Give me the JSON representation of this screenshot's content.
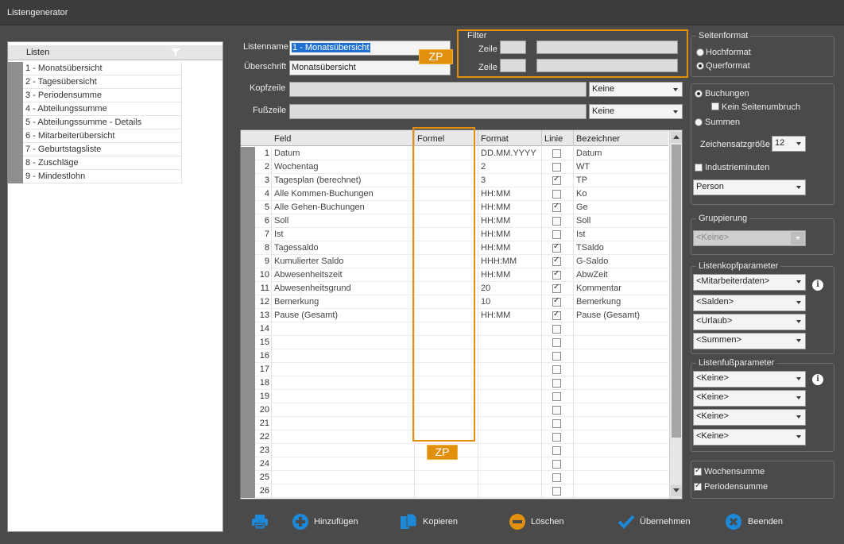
{
  "window": {
    "title": "Listengenerator"
  },
  "lists": {
    "header": "Listen",
    "items": [
      "1 - Monatsübersicht",
      "2 - Tagesübersicht",
      "3 - Periodensumme",
      "4 - Abteilungssumme",
      "5 - Abteilungssumme  - Details",
      "6 - Mitarbeiterübersicht",
      "7 - Geburtstagsliste",
      "8 - Zuschläge",
      "9 - Mindestlohn"
    ]
  },
  "form": {
    "listenname_label": "Listenname",
    "listenname_value": "1 - Monatsübersicht",
    "ueberschrift_label": "Überschrift",
    "ueberschrift_value": "Monatsübersicht",
    "kopfzeile_label": "Kopfzeile",
    "kopfzeile_value": "Keine",
    "fusszeile_label": "Fußzeile",
    "fusszeile_value": "Keine",
    "zp_label": "ZP"
  },
  "filter": {
    "title": "Filter",
    "zeile1_label": "Zeile",
    "zeile2_label": "Zeile"
  },
  "grid": {
    "columns": [
      "Feld",
      "Formel",
      "Format",
      "Linie",
      "Bezeichner"
    ],
    "rows": [
      {
        "nr": "1",
        "feld": "Datum",
        "format": "DD.MM.YYYY",
        "linie": false,
        "bez": "Datum"
      },
      {
        "nr": "2",
        "feld": "Wochentag",
        "format": "2",
        "linie": false,
        "bez": "WT"
      },
      {
        "nr": "3",
        "feld": "Tagesplan (berechnet)",
        "format": "3",
        "linie": true,
        "bez": "TP"
      },
      {
        "nr": "4",
        "feld": "Alle Kommen-Buchungen",
        "format": "HH:MM",
        "linie": false,
        "bez": "Ko"
      },
      {
        "nr": "5",
        "feld": "Alle Gehen-Buchungen",
        "format": "HH:MM",
        "linie": true,
        "bez": "Ge"
      },
      {
        "nr": "6",
        "feld": "Soll",
        "format": "HH:MM",
        "linie": false,
        "bez": "Soll"
      },
      {
        "nr": "7",
        "feld": "Ist",
        "format": "HH:MM",
        "linie": false,
        "bez": "Ist"
      },
      {
        "nr": "8",
        "feld": "Tagessaldo",
        "format": "HH:MM",
        "linie": true,
        "bez": "TSaldo"
      },
      {
        "nr": "9",
        "feld": "Kumulierter Saldo",
        "format": "HHH:MM",
        "linie": true,
        "bez": "G-Saldo"
      },
      {
        "nr": "10",
        "feld": "Abwesenheitszeit",
        "format": "HH:MM",
        "linie": true,
        "bez": "AbwZeit"
      },
      {
        "nr": "11",
        "feld": "Abwesenheitsgrund",
        "format": "20",
        "linie": true,
        "bez": "Kommentar"
      },
      {
        "nr": "12",
        "feld": "Bemerkung",
        "format": "10",
        "linie": true,
        "bez": "Bemerkung"
      },
      {
        "nr": "13",
        "feld": "Pause (Gesamt)",
        "format": "HH:MM",
        "linie": true,
        "bez": "Pause (Gesamt)"
      },
      {
        "nr": "14",
        "feld": "",
        "format": "",
        "linie": false,
        "bez": ""
      },
      {
        "nr": "15",
        "feld": "",
        "format": "",
        "linie": false,
        "bez": ""
      },
      {
        "nr": "16",
        "feld": "",
        "format": "",
        "linie": false,
        "bez": ""
      },
      {
        "nr": "17",
        "feld": "",
        "format": "",
        "linie": false,
        "bez": ""
      },
      {
        "nr": "18",
        "feld": "",
        "format": "",
        "linie": false,
        "bez": ""
      },
      {
        "nr": "19",
        "feld": "",
        "format": "",
        "linie": false,
        "bez": ""
      },
      {
        "nr": "20",
        "feld": "",
        "format": "",
        "linie": false,
        "bez": ""
      },
      {
        "nr": "21",
        "feld": "",
        "format": "",
        "linie": false,
        "bez": ""
      },
      {
        "nr": "22",
        "feld": "",
        "format": "",
        "linie": false,
        "bez": ""
      },
      {
        "nr": "23",
        "feld": "",
        "format": "",
        "linie": false,
        "bez": ""
      },
      {
        "nr": "24",
        "feld": "",
        "format": "",
        "linie": false,
        "bez": ""
      },
      {
        "nr": "25",
        "feld": "",
        "format": "",
        "linie": false,
        "bez": ""
      },
      {
        "nr": "26",
        "feld": "",
        "format": "",
        "linie": false,
        "bez": ""
      }
    ]
  },
  "seitenformat": {
    "title": "Seitenformat",
    "hochformat": "Hochformat",
    "querformat": "Querformat",
    "selected": "querformat"
  },
  "options": {
    "buchungen": "Buchungen",
    "kein_seitenumbruch": "Kein Seitenumbruch",
    "summen": "Summen",
    "zeichensatz_label": "Zeichensatzgröße",
    "zeichensatz_value": "12",
    "industrieminuten": "Industrieminuten",
    "person_value": "Person"
  },
  "gruppierung": {
    "title": "Gruppierung",
    "value": "<Keine>"
  },
  "listenkopf": {
    "title": "Listenkopfparameter",
    "values": [
      "<Mitarbeiterdaten>",
      "<Salden>",
      "<Urlaub>",
      "<Summen>"
    ]
  },
  "listenfuss": {
    "title": "Listenfußparameter",
    "values": [
      "<Keine>",
      "<Keine>",
      "<Keine>",
      "<Keine>"
    ]
  },
  "summen": {
    "wochensumme": "Wochensumme",
    "periodensumme": "Periodensumme"
  },
  "toolbar": {
    "hinzufuegen": "Hinzufügen",
    "kopieren": "Kopieren",
    "loeschen": "Löschen",
    "uebernehmen": "Übernehmen",
    "beenden": "Beenden"
  },
  "colors": {
    "accent_orange": "#e0900c",
    "icon_blue": "#1e88d8"
  }
}
